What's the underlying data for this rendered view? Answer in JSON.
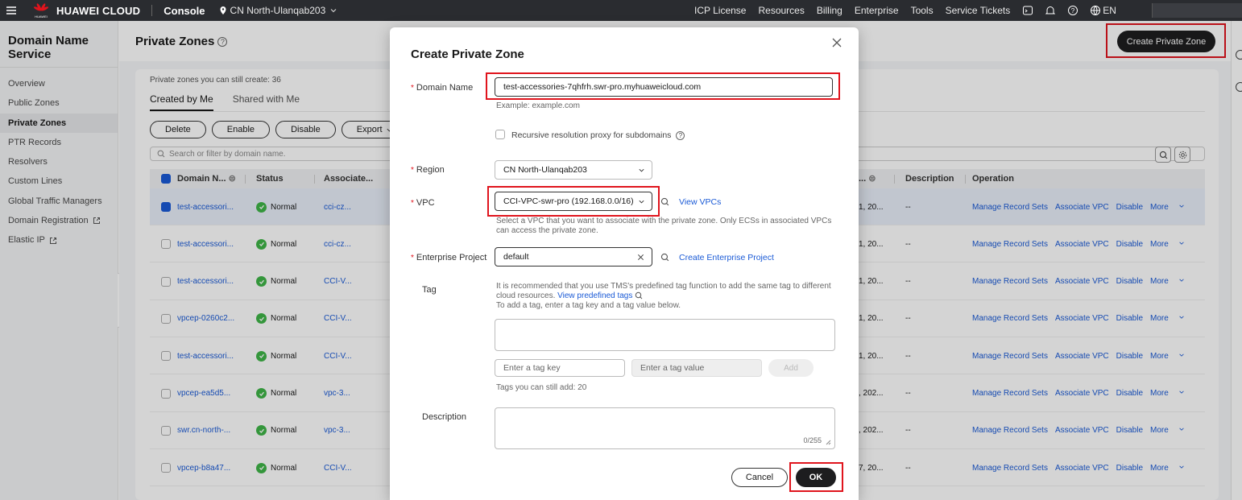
{
  "topnav": {
    "brand": "HUAWEI CLOUD",
    "logo_sub": "HUAWEI",
    "console": "Console",
    "region": "CN North-Ulanqab203",
    "links": [
      "ICP License",
      "Resources",
      "Billing",
      "Enterprise",
      "Tools",
      "Service Tickets"
    ],
    "language": "EN"
  },
  "sidebar": {
    "title": "Domain Name Service",
    "items": [
      {
        "label": "Overview"
      },
      {
        "label": "Public Zones"
      },
      {
        "label": "Private Zones",
        "active": true
      },
      {
        "label": "PTR Records"
      },
      {
        "label": "Resolvers"
      },
      {
        "label": "Custom Lines"
      },
      {
        "label": "Global Traffic Managers"
      },
      {
        "label": "Domain Registration",
        "external": true
      },
      {
        "label": "Elastic IP",
        "external": true
      }
    ]
  },
  "page": {
    "title": "Private Zones",
    "create_button": "Create Private Zone",
    "quota_text": "Private zones you can still create: 36",
    "tabs": [
      "Created by Me",
      "Shared with Me"
    ],
    "actions": [
      "Delete",
      "Enable",
      "Disable",
      "Export"
    ],
    "search_placeholder": "Search or filter by domain name."
  },
  "table": {
    "columns": [
      "Domain N...",
      "Status",
      "Associate...",
      "...",
      "Description",
      "Operation"
    ],
    "rows": [
      {
        "domain": "test-accessori...",
        "status": "Normal",
        "assoc": "cci-cz...",
        "created": "1, 20...",
        "desc": "--",
        "selected": true
      },
      {
        "domain": "test-accessori...",
        "status": "Normal",
        "assoc": "cci-cz...",
        "created": "1, 20...",
        "desc": "--",
        "selected": false
      },
      {
        "domain": "test-accessori...",
        "status": "Normal",
        "assoc": "CCI-V...",
        "created": "1, 20...",
        "desc": "--",
        "selected": false
      },
      {
        "domain": "vpcep-0260c2...",
        "status": "Normal",
        "assoc": "CCI-V...",
        "created": "1, 20...",
        "desc": "--",
        "selected": false
      },
      {
        "domain": "test-accessori...",
        "status": "Normal",
        "assoc": "CCI-V...",
        "created": "1, 20...",
        "desc": "--",
        "selected": false
      },
      {
        "domain": "vpcep-ea5d5...",
        "status": "Normal",
        "assoc": "vpc-3...",
        "created": ", 202...",
        "desc": "--",
        "selected": false
      },
      {
        "domain": "swr.cn-north-...",
        "status": "Normal",
        "assoc": "vpc-3...",
        "created": ", 202...",
        "desc": "--",
        "selected": false
      },
      {
        "domain": "vpcep-b8a47...",
        "status": "Normal",
        "assoc": "CCI-V...",
        "created": "7, 20...",
        "desc": "--",
        "selected": false
      }
    ],
    "operations": [
      "Manage Record Sets",
      "Associate VPC",
      "Disable",
      "More"
    ]
  },
  "modal": {
    "title": "Create Private Zone",
    "domain_label": "Domain Name",
    "domain_value": "test-accessories-7qhfrh.swr-pro.myhuaweicloud.com",
    "domain_example": "Example: example.com",
    "recursive_label": "Recursive resolution proxy for subdomains",
    "region_label": "Region",
    "region_value": "CN North-Ulanqab203",
    "vpc_label": "VPC",
    "vpc_value": "CCI-VPC-swr-pro (192.168.0.0/16)",
    "view_vpcs": "View VPCs",
    "vpc_hint": "Select a VPC that you want to associate with the private zone. Only ECSs in associated VPCs can access the private zone.",
    "ep_label": "Enterprise Project",
    "ep_value": "default",
    "create_ep": "Create Enterprise Project",
    "tag_label": "Tag",
    "tag_hint1": "It is recommended that you use TMS's predefined tag function to add the same tag to different cloud resources.",
    "view_predefined": "View predefined tags",
    "tag_hint2": "To add a tag, enter a tag key and a tag value below.",
    "tag_key_placeholder": "Enter a tag key",
    "tag_value_placeholder": "Enter a tag value",
    "add_button": "Add",
    "tags_remaining": "Tags you can still add: 20",
    "desc_label": "Description",
    "desc_counter": "0/255",
    "cancel": "Cancel",
    "ok": "OK"
  },
  "colors": {
    "accent": "#1a5ad6",
    "highlight": "#e0141d",
    "normal": "#3fb548",
    "dark": "#1d1d1f"
  }
}
